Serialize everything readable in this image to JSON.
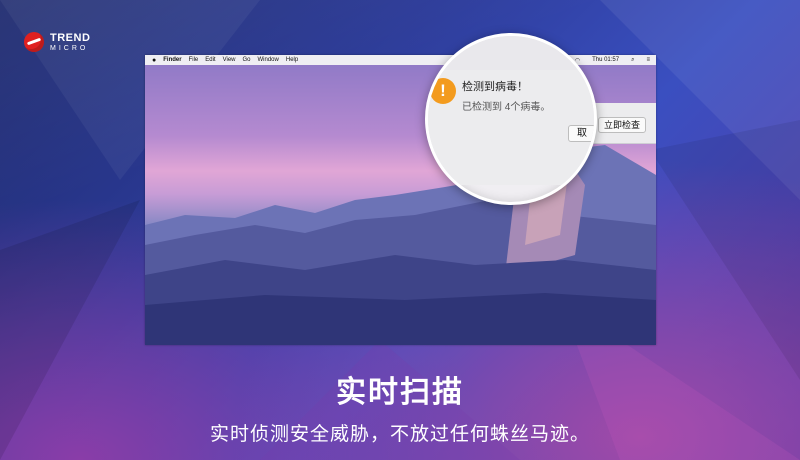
{
  "brand": {
    "line1": "TREND",
    "line2": "MICRO"
  },
  "mac": {
    "menubar": {
      "app": "Finder",
      "items": [
        "File",
        "Edit",
        "View",
        "Go",
        "Window",
        "Help"
      ],
      "clock": "Thu 01:57"
    }
  },
  "notification": {
    "title": "检测到病毒！",
    "body": "已检测到 4个病毒。",
    "cancel_label": "取",
    "check_label": "立即检查"
  },
  "feature": {
    "title": "实时扫描",
    "subtitle": "实时侦测安全威胁，不放过任何蛛丝马迹。"
  },
  "colors": {
    "brand_red": "#e02020",
    "warning_orange": "#f39b1e",
    "background_blue": "#2d3c9a"
  }
}
